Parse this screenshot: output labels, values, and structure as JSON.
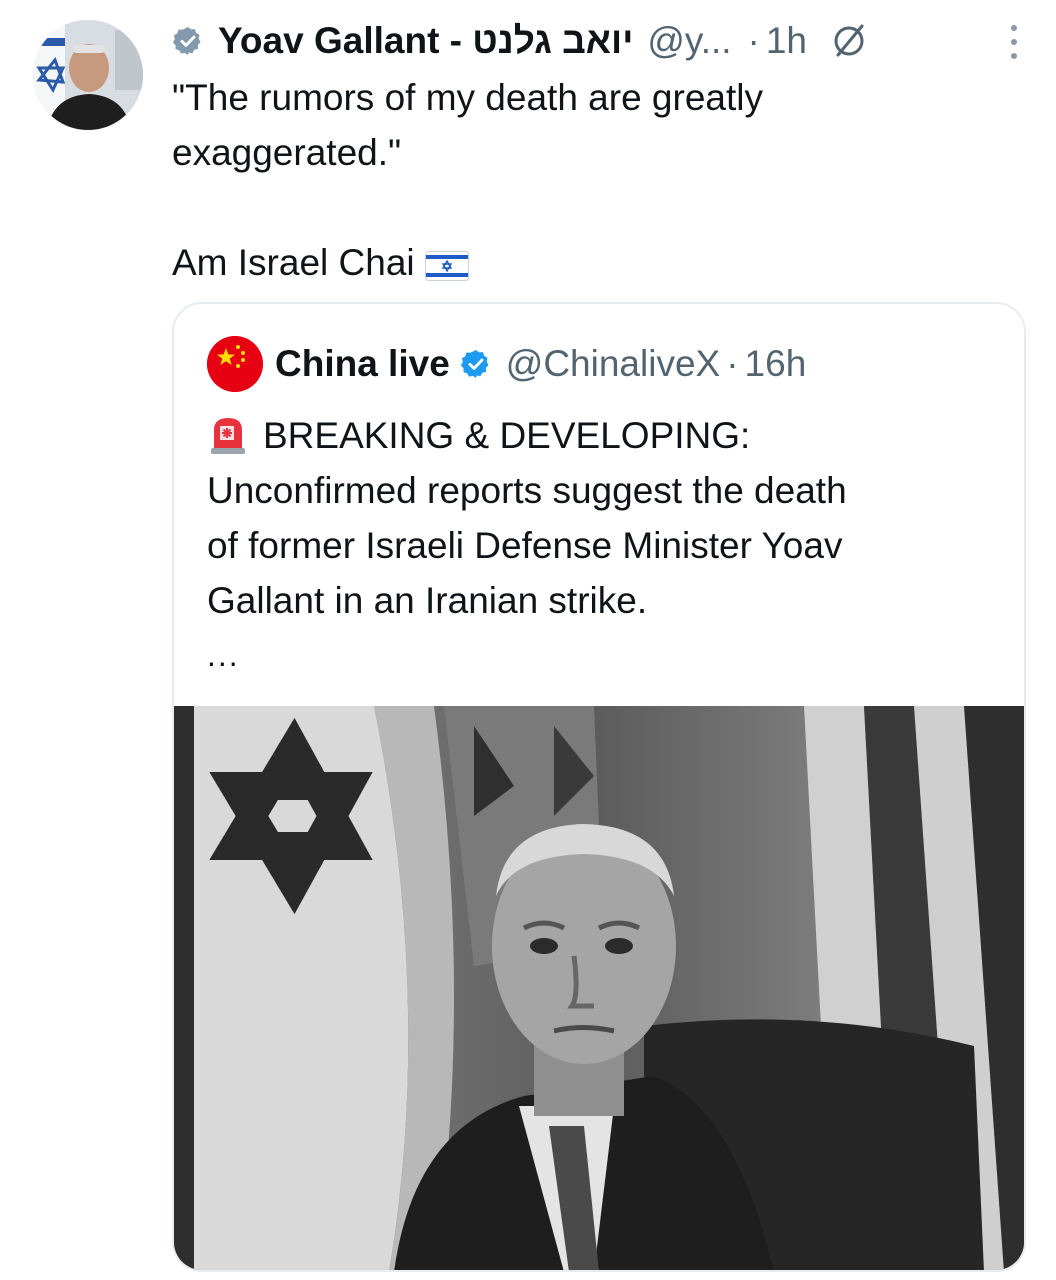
{
  "tweet": {
    "display_name": "Yoav Gallant - יואב גלנט",
    "handle": "@y...",
    "separator": "·",
    "time": "1h",
    "text_line1": "\"The rumors of my death are greatly",
    "text_line2": "exaggerated.\"",
    "text_line3": "Am Israel Chai",
    "flag_emoji": "israel-flag-emoji"
  },
  "quote": {
    "display_name": "China live",
    "handle": "@ChinaliveX",
    "separator": "·",
    "time": "16h",
    "headline": "BREAKING & DEVELOPING:",
    "body_line1": "Unconfirmed reports suggest the death",
    "body_line2": "of former Israeli Defense Minister Yoav",
    "body_line3": "Gallant in an Iranian strike.",
    "ellipsis": "...",
    "siren_emoji": "police-siren-emoji"
  },
  "colors": {
    "verified_gray": "#829aab",
    "verified_blue": "#1d9bf0",
    "muted_text": "#536471",
    "china_red": "#e60012",
    "china_yellow": "#ffde00"
  }
}
